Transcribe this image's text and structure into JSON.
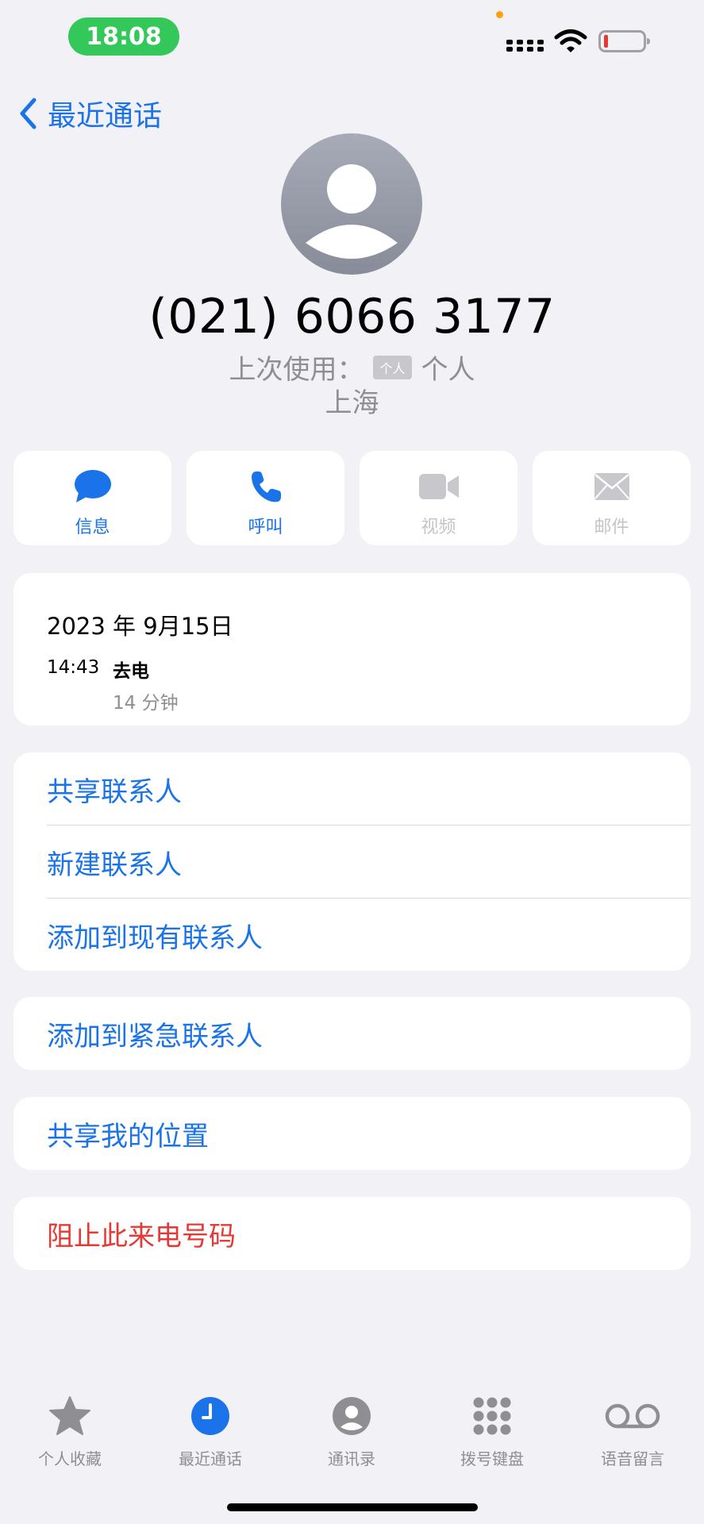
{
  "status_bar": {
    "time": "18:08"
  },
  "nav": {
    "back_label": "最近通话"
  },
  "contact": {
    "phone_number": "(021) 6066 3177",
    "last_used_label": "上次使用：",
    "last_used_chip": "个人",
    "last_used_value": "个人",
    "location": "上海"
  },
  "actions": [
    {
      "label": "信息",
      "icon": "message-bubble-icon",
      "enabled": true
    },
    {
      "label": "呼叫",
      "icon": "phone-icon",
      "enabled": true
    },
    {
      "label": "视频",
      "icon": "video-camera-icon",
      "enabled": false
    },
    {
      "label": "邮件",
      "icon": "envelope-icon",
      "enabled": false
    }
  ],
  "call_history": {
    "date": "2023 年 9月15日",
    "entries": [
      {
        "time": "14:43",
        "type": "去电",
        "duration": "14 分钟"
      }
    ]
  },
  "contact_options": [
    "共享联系人",
    "新建联系人",
    "添加到现有联系人"
  ],
  "emergency_option": "添加到紧急联系人",
  "location_option": "共享我的位置",
  "block_option": "阻止此来电号码",
  "tabbar": {
    "items": [
      {
        "label": "个人收藏",
        "icon": "star-icon",
        "active": false
      },
      {
        "label": "最近通话",
        "icon": "clock-icon",
        "active": true
      },
      {
        "label": "通讯录",
        "icon": "person-circle-icon",
        "active": false
      },
      {
        "label": "拨号键盘",
        "icon": "keypad-icon",
        "active": false
      },
      {
        "label": "语音留言",
        "icon": "voicemail-icon",
        "active": false
      }
    ]
  },
  "colors": {
    "accent": "#1a73e8",
    "danger": "#e53935",
    "status_green": "#34c759",
    "background": "#f1f1f6"
  }
}
